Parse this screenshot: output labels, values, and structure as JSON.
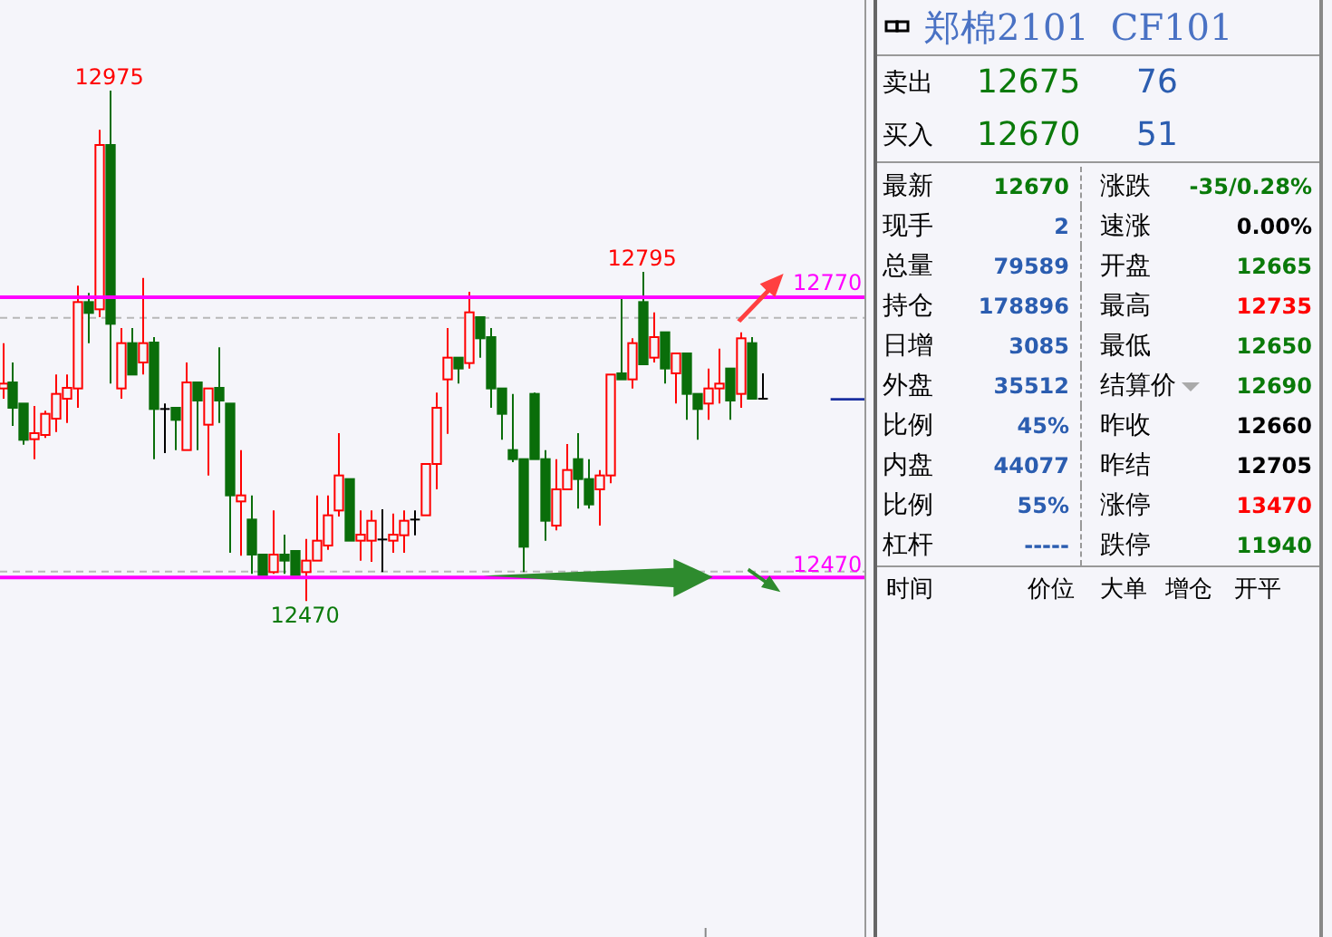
{
  "chart": {
    "high_label": "12975",
    "peak_label": "12795",
    "low_label": "12470",
    "resistance_label": "12770",
    "support_label": "12470"
  },
  "quote": {
    "name": "郑棉2101",
    "code": "CF101"
  },
  "order_book": [
    {
      "label": "卖出",
      "price": "12675",
      "volume": "76"
    },
    {
      "label": "买入",
      "price": "12670",
      "volume": "51"
    }
  ],
  "stats": [
    {
      "left": {
        "label": "最新",
        "value": "12670",
        "color": "#0a7a0a"
      },
      "right": {
        "label": "涨跌",
        "value": "-35/0.28%",
        "color": "#0a7a0a"
      }
    },
    {
      "left": {
        "label": "现手",
        "value": "2",
        "color": "#2b5db0"
      },
      "right": {
        "label": "速涨",
        "value": "0.00%",
        "color": "#000000"
      }
    },
    {
      "left": {
        "label": "总量",
        "value": "79589",
        "color": "#2b5db0"
      },
      "right": {
        "label": "开盘",
        "value": "12665",
        "color": "#0a7a0a"
      }
    },
    {
      "left": {
        "label": "持仓",
        "value": "178896",
        "color": "#2b5db0"
      },
      "right": {
        "label": "最高",
        "value": "12735",
        "color": "#ff0000"
      }
    },
    {
      "left": {
        "label": "日增",
        "value": "3085",
        "color": "#2b5db0"
      },
      "right": {
        "label": "最低",
        "value": "12650",
        "color": "#0a7a0a"
      }
    },
    {
      "left": {
        "label": "外盘",
        "value": "35512",
        "color": "#2b5db0"
      },
      "right": {
        "label": "结算价",
        "value": "12690",
        "color": "#0a7a0a",
        "dropdown": true
      }
    },
    {
      "left": {
        "label": "比例",
        "value": "45%",
        "color": "#2b5db0"
      },
      "right": {
        "label": "昨收",
        "value": "12660",
        "color": "#000000"
      }
    },
    {
      "left": {
        "label": "内盘",
        "value": "44077",
        "color": "#2b5db0"
      },
      "right": {
        "label": "昨结",
        "value": "12705",
        "color": "#000000"
      }
    },
    {
      "left": {
        "label": "比例",
        "value": "55%",
        "color": "#2b5db0"
      },
      "right": {
        "label": "涨停",
        "value": "13470",
        "color": "#ff0000"
      }
    },
    {
      "left": {
        "label": "杠杆",
        "value": "-----",
        "color": "#2b5db0"
      },
      "right": {
        "label": "跌停",
        "value": "11940",
        "color": "#0a7a0a"
      }
    }
  ],
  "trades": {
    "columns": [
      "时间",
      "价位",
      "大单",
      "增仓",
      "开平"
    ]
  }
}
